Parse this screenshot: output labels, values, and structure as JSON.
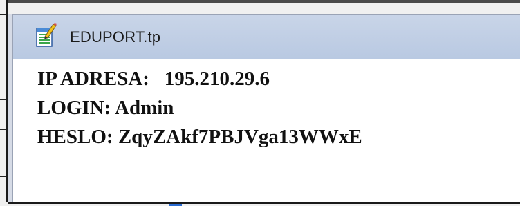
{
  "window": {
    "title": "EDUPORT.tp",
    "icon": "notepad-pencil-icon"
  },
  "document": {
    "lines": [
      {
        "label": "IP ADRESA:",
        "value": "195.210.29.6"
      },
      {
        "label": "LOGIN:",
        "value": "Admin"
      },
      {
        "label": "HESLO:",
        "value": "ZqyZAkf7PBJVga13WWxE"
      }
    ]
  },
  "colors": {
    "title_bar": "#c4d2e8",
    "text": "#111111"
  }
}
